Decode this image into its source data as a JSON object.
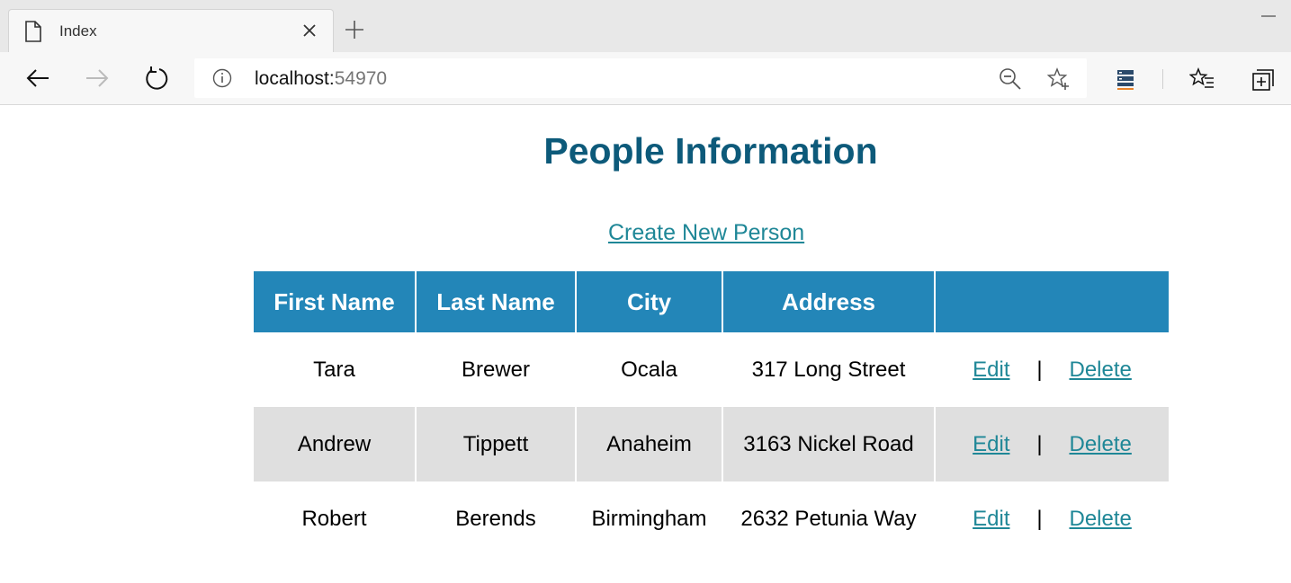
{
  "browser": {
    "tab_title": "Index",
    "url_host": "localhost:",
    "url_port": "54970"
  },
  "page": {
    "title": "People Information",
    "create_link": "Create New Person"
  },
  "table": {
    "headers": [
      "First Name",
      "Last Name",
      "City",
      "Address",
      ""
    ],
    "rows": [
      {
        "first": "Tara",
        "last": "Brewer",
        "city": "Ocala",
        "address": "317 Long Street",
        "edit": "Edit",
        "sep": "|",
        "delete": "Delete"
      },
      {
        "first": "Andrew",
        "last": "Tippett",
        "city": "Anaheim",
        "address": "3163 Nickel Road",
        "edit": "Edit",
        "sep": "|",
        "delete": "Delete"
      },
      {
        "first": "Robert",
        "last": "Berends",
        "city": "Birmingham",
        "address": "2632 Petunia Way",
        "edit": "Edit",
        "sep": "|",
        "delete": "Delete"
      }
    ]
  },
  "colors": {
    "header_bg": "#2386b8",
    "title": "#0d5a7a",
    "link": "#1f8797",
    "alt_row": "#dfdfdf"
  }
}
